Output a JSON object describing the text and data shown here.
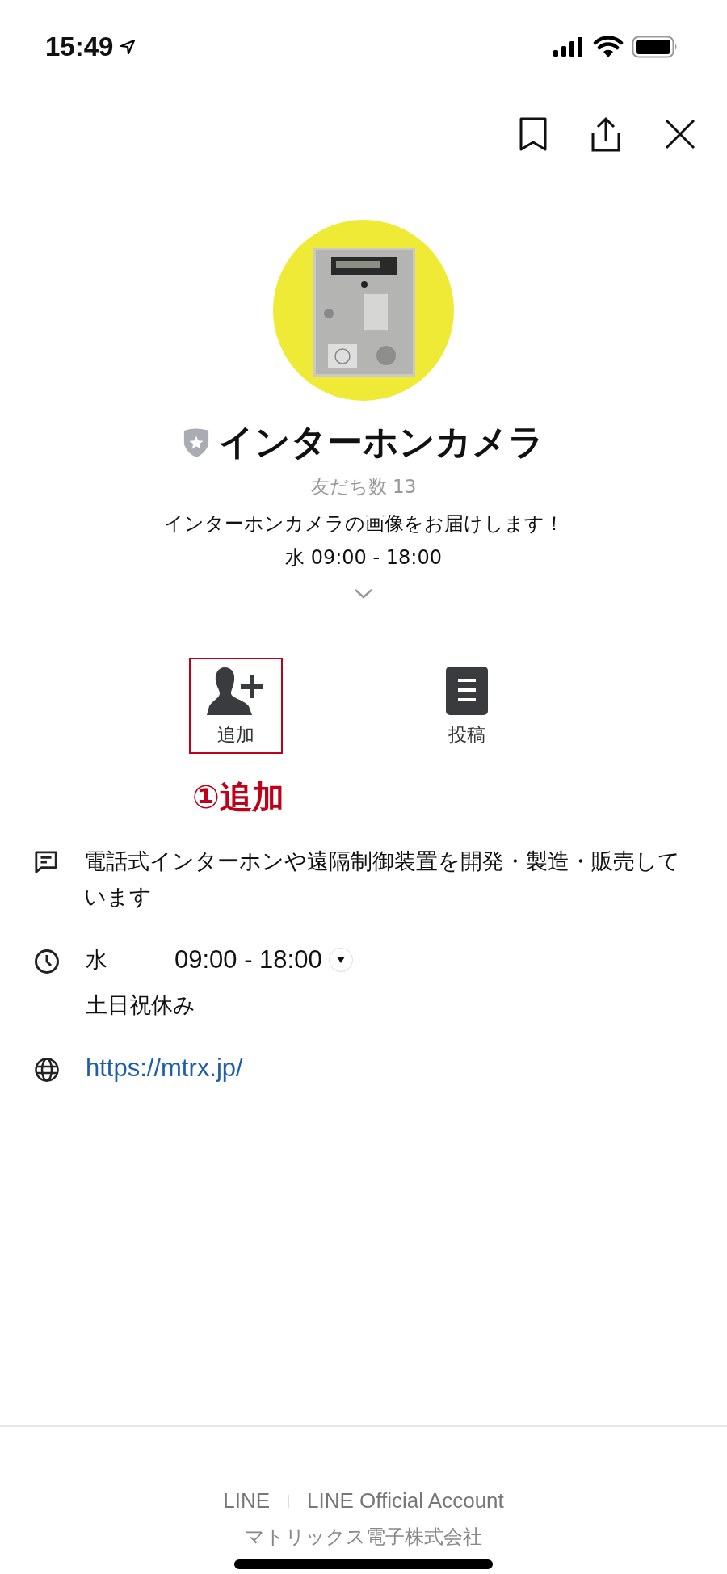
{
  "status_bar": {
    "time": "15:49"
  },
  "profile": {
    "name": "インターホンカメラ",
    "friends": "友だち数 13",
    "description": "インターホンカメラの画像をお届けします！",
    "hours": "水 09:00 - 18:00"
  },
  "actions": [
    {
      "label": "追加",
      "kind": "add",
      "highlighted": true
    },
    {
      "label": "投稿",
      "kind": "posts",
      "highlighted": false
    }
  ],
  "annotation": {
    "label": "①追加"
  },
  "info": [
    {
      "kind": "about",
      "lines": [
        "電話式インターホンや遠隔制御装置を開発・製造・販売しています"
      ]
    },
    {
      "kind": "hours",
      "day": "水",
      "time": "09:00 - 18:00",
      "note": "土日祝休み"
    },
    {
      "kind": "link",
      "url": "https://mtrx.jp/"
    }
  ],
  "footer": {
    "links": [
      "LINE",
      "LINE Official Account"
    ],
    "company": "マトリックス電子株式会社"
  }
}
